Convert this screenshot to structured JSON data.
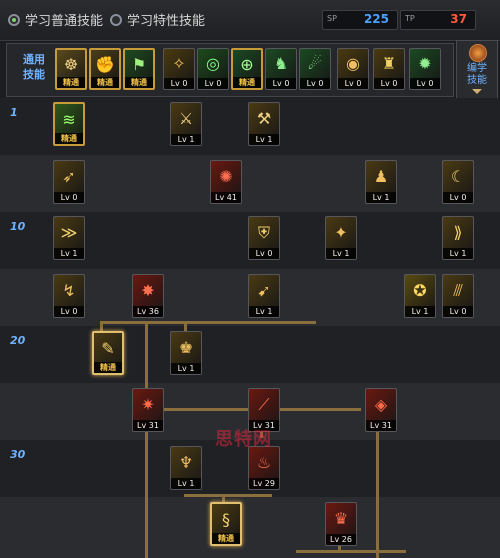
{
  "header": {
    "radio1_label": "学习普通技能",
    "radio2_label": "学习特性技能",
    "sp_label_1": "SP",
    "sp_value_1": "225",
    "sp_label_2": "TP",
    "sp_value_2": "37",
    "sp_color_1": "#4aa0ff",
    "sp_color_2": "#ff5a3a"
  },
  "tabs": {
    "category_line1": "通用",
    "category_line2": "技能",
    "items": [
      {
        "label": "精通",
        "type": "elite",
        "icon": "meditate-icon",
        "glyph": "☸",
        "bg": "#5a4a1c",
        "fg": "#f0d080"
      },
      {
        "label": "精通",
        "type": "elite",
        "icon": "fist-icon",
        "glyph": "✊",
        "bg": "#4a3e18",
        "fg": "#f0d080"
      },
      {
        "label": "精通",
        "type": "elite",
        "icon": "runner-icon",
        "glyph": "⚑",
        "bg": "#1f4a1f",
        "fg": "#a0f080"
      },
      {
        "label": "Lv 0",
        "type": "level",
        "icon": "wings-icon",
        "glyph": "✧",
        "bg": "#4a3a10",
        "fg": "#f0c060"
      },
      {
        "label": "Lv 0",
        "type": "level",
        "icon": "target-icon",
        "glyph": "◎",
        "bg": "#1c4a1c",
        "fg": "#8aff8a"
      },
      {
        "label": "精通",
        "type": "elite",
        "icon": "crosshair-icon",
        "glyph": "⊕",
        "bg": "#1c4a22",
        "fg": "#a0ff90"
      },
      {
        "label": "Lv 0",
        "type": "level",
        "icon": "kneel-icon",
        "glyph": "♞",
        "bg": "#1c4a22",
        "fg": "#90f090"
      },
      {
        "label": "Lv 0",
        "type": "level",
        "icon": "leap-icon",
        "glyph": "☄",
        "bg": "#1c4a22",
        "fg": "#90f090"
      },
      {
        "label": "Lv 0",
        "type": "level",
        "icon": "eye-icon",
        "glyph": "◉",
        "bg": "#4a3a10",
        "fg": "#f0c060"
      },
      {
        "label": "Lv 0",
        "type": "level",
        "icon": "strongman-icon",
        "glyph": "♜",
        "bg": "#4a3a10",
        "fg": "#f0d060"
      },
      {
        "label": "Lv 0",
        "type": "level",
        "icon": "blade-spin-icon",
        "glyph": "✹",
        "bg": "#1c4a22",
        "fg": "#90f090"
      }
    ]
  },
  "side_button": {
    "line1": "编学",
    "line2": "技能"
  },
  "rows": [
    {
      "label": "1"
    },
    {
      "label": ""
    },
    {
      "label": "10"
    },
    {
      "label": ""
    },
    {
      "label": "20"
    },
    {
      "label": ""
    },
    {
      "label": "30"
    },
    {
      "label": ""
    }
  ],
  "skills": [
    {
      "name": "thunder-claw",
      "label": "精通",
      "type": "elite",
      "glyph": "≋",
      "bg": "#2f5a1c",
      "fg": "#a0ff70"
    },
    {
      "name": "dagger-throw",
      "label": "Lv 1",
      "type": "level",
      "glyph": "⚔",
      "bg": "#4a3a14",
      "fg": "#f0d080"
    },
    {
      "name": "hammer-strike",
      "label": "Lv 1",
      "type": "level",
      "glyph": "⚒",
      "bg": "#4a3a14",
      "fg": "#f0d080"
    },
    {
      "name": "dash",
      "label": "Lv 0",
      "type": "level",
      "glyph": "➶",
      "bg": "#4a3a14",
      "fg": "#f0c060"
    },
    {
      "name": "fire-burst",
      "label": "Lv 41",
      "type": "level",
      "glyph": "✺",
      "bg": "#6a1810",
      "fg": "#ff7050"
    },
    {
      "name": "shadow-step",
      "label": "Lv 1",
      "type": "level",
      "glyph": "♟",
      "bg": "#4a3a14",
      "fg": "#f0c060"
    },
    {
      "name": "crescent-slash",
      "label": "Lv 0",
      "type": "level",
      "glyph": "☾",
      "bg": "#4a3a14",
      "fg": "#f0d070"
    },
    {
      "name": "wind-slash",
      "label": "Lv 1",
      "type": "level",
      "glyph": "≫",
      "bg": "#4a3a14",
      "fg": "#f0d070"
    },
    {
      "name": "shield-guard",
      "label": "Lv 0",
      "type": "level",
      "glyph": "⛨",
      "bg": "#4a3a14",
      "fg": "#f0d070"
    },
    {
      "name": "tumble",
      "label": "Lv 1",
      "type": "level",
      "glyph": "✦",
      "bg": "#4a3a14",
      "fg": "#f0c060"
    },
    {
      "name": "twin-claw",
      "label": "Lv 1",
      "type": "level",
      "glyph": "⟫",
      "bg": "#4a3a14",
      "fg": "#f0d070"
    },
    {
      "name": "kick",
      "label": "Lv 0",
      "type": "level",
      "glyph": "↯",
      "bg": "#4a3a14",
      "fg": "#f0c060"
    },
    {
      "name": "flame-wave",
      "label": "Lv 36",
      "type": "level",
      "glyph": "✸",
      "bg": "#6a1810",
      "fg": "#ff7050"
    },
    {
      "name": "spear-thrust",
      "label": "Lv 1",
      "type": "level",
      "glyph": "➹",
      "bg": "#4a3a14",
      "fg": "#f0c060"
    },
    {
      "name": "gold-aura",
      "label": "Lv 1",
      "type": "level",
      "glyph": "✪",
      "bg": "#5a4a10",
      "fg": "#ffd860"
    },
    {
      "name": "triple-cut",
      "label": "Lv 0",
      "type": "level",
      "glyph": "⫻",
      "bg": "#4a3a14",
      "fg": "#f0c060"
    },
    {
      "name": "feather-blade",
      "label": "精通",
      "type": "elite",
      "glyph": "✎",
      "bg": "#4a3a14",
      "fg": "#f0d070"
    },
    {
      "name": "roar",
      "label": "Lv 1",
      "type": "level",
      "glyph": "♚",
      "bg": "#4a3a14",
      "fg": "#f0c060"
    },
    {
      "name": "blood-vortex",
      "label": "Lv 31",
      "type": "level",
      "glyph": "✷",
      "bg": "#6a1810",
      "fg": "#ff6a4a"
    },
    {
      "name": "claw-rend",
      "label": "Lv 31",
      "type": "level",
      "glyph": "⟋",
      "bg": "#6a1810",
      "fg": "#ff6a4a"
    },
    {
      "name": "demon-eye",
      "label": "Lv 31",
      "type": "level",
      "glyph": "◈",
      "bg": "#6a1810",
      "fg": "#ff6a4a"
    },
    {
      "name": "beast-fang",
      "label": "Lv 1",
      "type": "level",
      "glyph": "♆",
      "bg": "#4a3a14",
      "fg": "#f0c060"
    },
    {
      "name": "dragon-flame",
      "label": "Lv 29",
      "type": "level",
      "glyph": "♨",
      "bg": "#6a1810",
      "fg": "#ff7050"
    },
    {
      "name": "serpent-coil",
      "label": "精通",
      "type": "elite",
      "glyph": "§",
      "bg": "#4a3a14",
      "fg": "#f0d070"
    },
    {
      "name": "crimson-armor",
      "label": "Lv 26",
      "type": "level",
      "glyph": "♛",
      "bg": "#6a1810",
      "fg": "#ff7050"
    }
  ],
  "watermark": "思特网"
}
